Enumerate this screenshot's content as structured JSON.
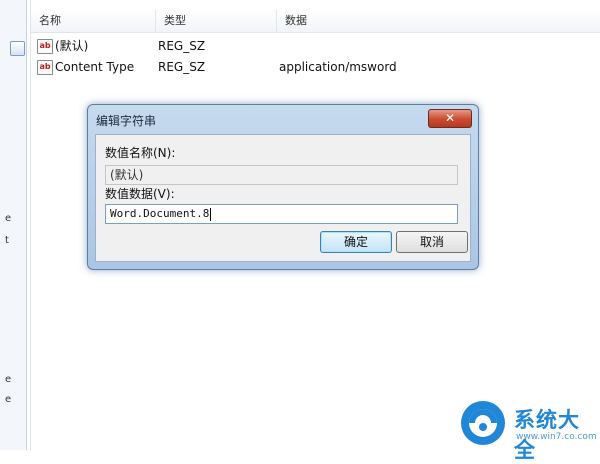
{
  "left_pane": {
    "letters": [
      "e",
      "t",
      "e",
      "e"
    ]
  },
  "list": {
    "columns": [
      "名称",
      "类型",
      "数据"
    ],
    "rows": [
      {
        "icon": "string-value-icon",
        "icon_text": "ab",
        "name": "(默认)",
        "type": "REG_SZ",
        "data": ""
      },
      {
        "icon": "string-value-icon",
        "icon_text": "ab",
        "name": "Content Type",
        "type": "REG_SZ",
        "data": "application/msword"
      }
    ]
  },
  "dialog": {
    "title": "编辑字符串",
    "close_label": "✕",
    "name_label": "数值名称(N):",
    "name_value": "(默认)",
    "data_label": "数值数据(V):",
    "data_value": "Word.Document.8",
    "ok_label": "确定",
    "cancel_label": "取消"
  },
  "watermark": {
    "text": "系统大全",
    "url": "www.win7.co.com"
  },
  "colors": {
    "accent": "#1f86d8",
    "dialog_frame": "#aac6e4",
    "close_red": "#c94a31"
  }
}
